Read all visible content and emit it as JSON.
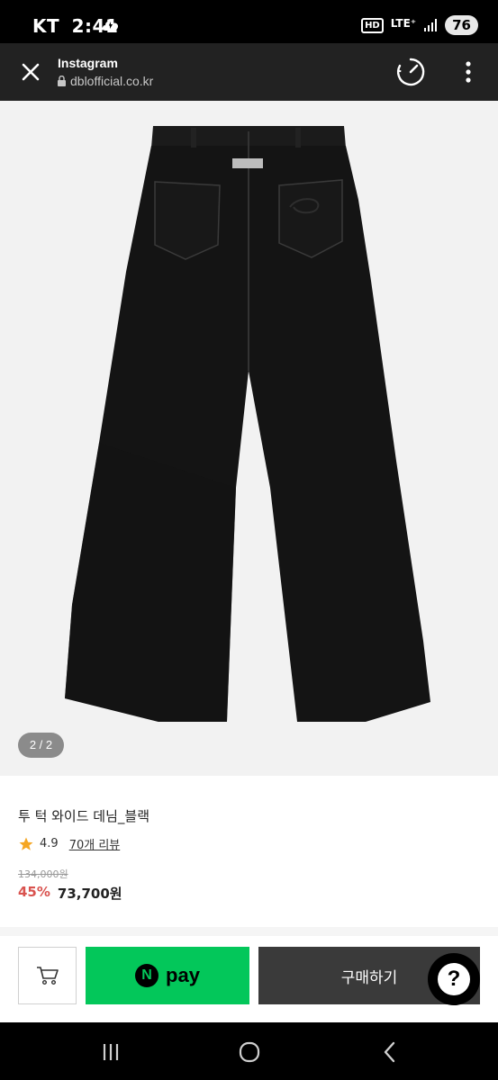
{
  "status_bar": {
    "carrier": "KT",
    "time": "2:41",
    "hd": "HD",
    "network": "LTE⁺",
    "battery": "76"
  },
  "browser": {
    "title": "Instagram",
    "url": "dblofficial.co.kr"
  },
  "product": {
    "image_counter": "2 / 2",
    "name": "투 턱 와이드 데님_블랙",
    "rating": "4.9",
    "review_link": "70개 리뷰",
    "original_price": "134,000원",
    "discount": "45%",
    "sale_price": "73,700원"
  },
  "actions": {
    "npay_logo": "N",
    "npay_label": "pay",
    "buy_label": "구매하기",
    "help_label": "?"
  },
  "colors": {
    "npay_green": "#03c75a",
    "discount_red": "#d9534f",
    "buy_dark": "#3a3a3a"
  },
  "icons": [
    "cloud-icon",
    "close-icon",
    "lock-icon",
    "speed-icon",
    "more-vertical-icon",
    "star-icon",
    "cart-icon",
    "recent-apps-icon",
    "home-icon",
    "back-icon"
  ]
}
